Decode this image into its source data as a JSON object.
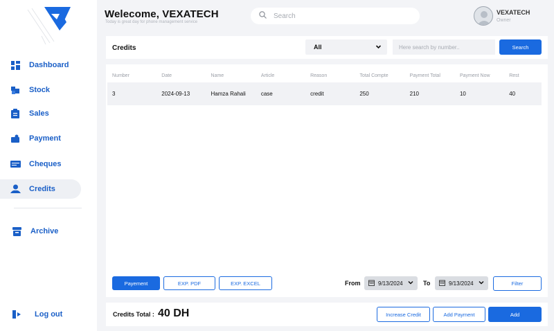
{
  "header": {
    "welcome": "Welecome, VEXATECH",
    "subtitle": "Today is great day for phone management service",
    "search_placeholder": "Search",
    "user_name": "VEXATECH",
    "user_role": "Owner"
  },
  "sidebar": {
    "items": [
      {
        "label": "Dashboard",
        "icon": "dashboard-icon"
      },
      {
        "label": "Stock",
        "icon": "stock-icon"
      },
      {
        "label": "Sales",
        "icon": "sales-icon"
      },
      {
        "label": "Payment",
        "icon": "payment-icon"
      },
      {
        "label": "Cheques",
        "icon": "cheques-icon"
      },
      {
        "label": "Credits",
        "icon": "credits-icon",
        "active": true
      },
      {
        "label": "Archive",
        "icon": "archive-icon"
      }
    ],
    "logout": "Log out"
  },
  "credits": {
    "title": "Credits",
    "filter_selected": "All",
    "number_search_placeholder": "Here search by number..",
    "search_button": "Search",
    "columns": [
      "Number",
      "Date",
      "Name",
      "Article",
      "Reason",
      "Total Compte",
      "Payment Total",
      "Payment Now",
      "Rest"
    ],
    "rows": [
      [
        "3",
        "2024-09-13",
        "Hamza Rahali",
        "case",
        "credit",
        "250",
        "210",
        "10",
        "40"
      ]
    ],
    "payment_button": "Payement",
    "exp_pdf": "EXP. PDF",
    "exp_excel": "EXP. EXCEL",
    "from_label": "From",
    "from_date": "9/13/2024",
    "to_label": "To",
    "to_date": "9/13/2024",
    "filter_button": "Filter"
  },
  "footer": {
    "total_label": "Credits Total :",
    "total_value": "40 DH",
    "increase_credit": "Increase Credit",
    "add_payment": "Add Payment",
    "add": "Add"
  },
  "colors": {
    "accent": "#1a6ae0",
    "nav_text": "#1a5fc7",
    "background": "#f3f4f7"
  }
}
